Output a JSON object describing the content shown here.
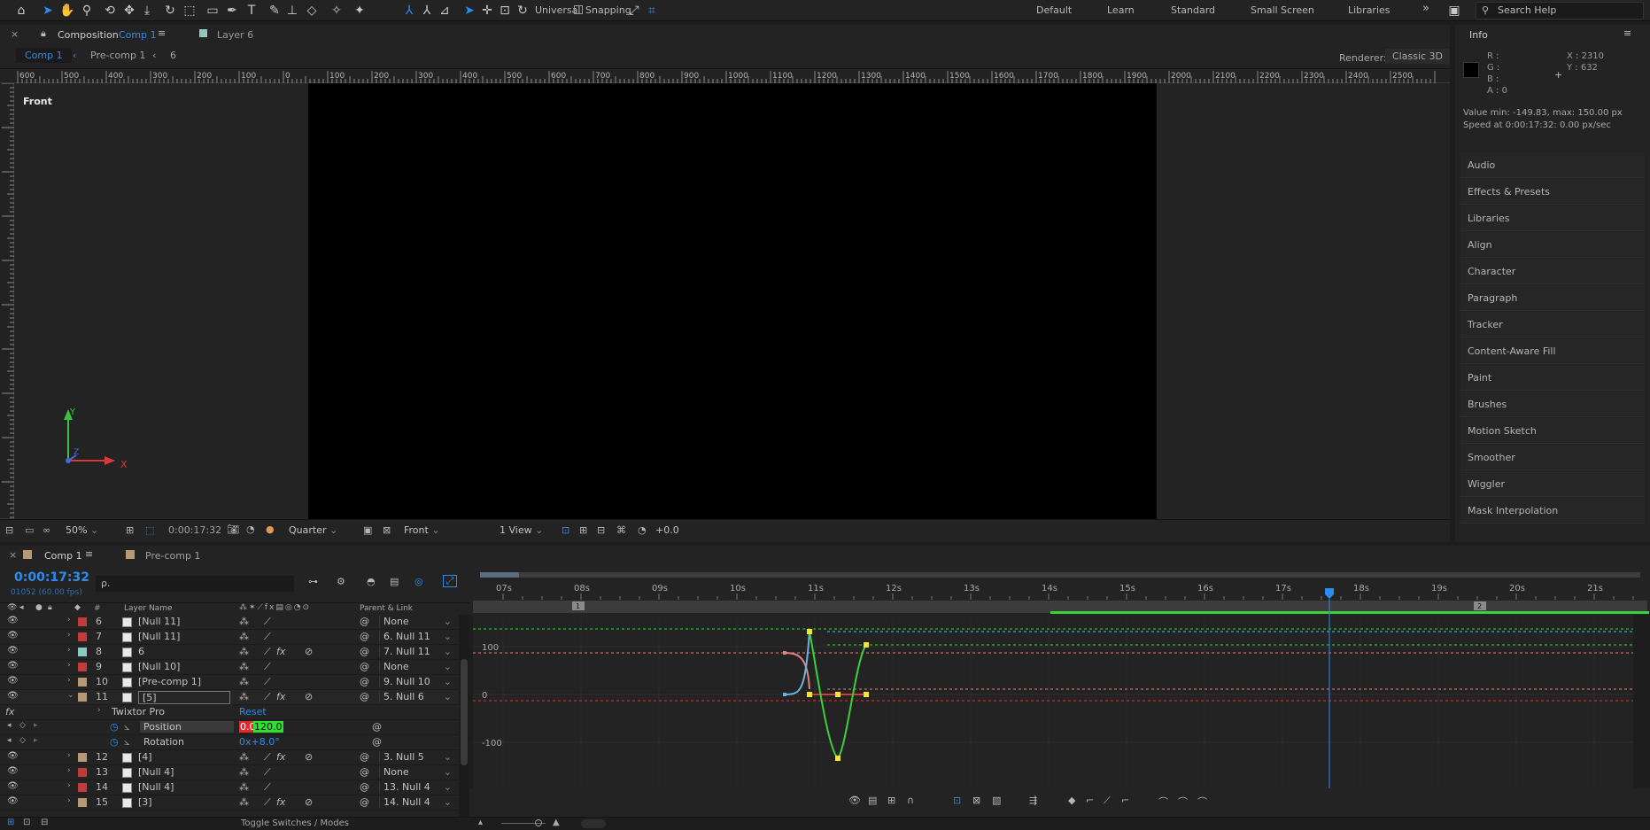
{
  "toolbar": {
    "universal_label": "Universal",
    "snapping_label": "Snapping",
    "workspaces": [
      "Default",
      "Learn",
      "Standard",
      "Small Screen",
      "Libraries"
    ],
    "more": "»",
    "search_placeholder": "Search Help"
  },
  "comp_panel": {
    "tab_label": "Composition",
    "tab_name": "Comp 1",
    "layer_tab": "Layer 6",
    "breadcrumb": [
      "Comp 1",
      "Pre-comp 1",
      "6"
    ],
    "renderer_label": "Renderer:",
    "renderer_value": "Classic 3D",
    "view_label": "Front",
    "ruler_ticks": [
      "600",
      "500",
      "400",
      "300",
      "200",
      "100",
      "0",
      "100",
      "200",
      "300",
      "400",
      "500",
      "600",
      "700",
      "800",
      "900",
      "1000",
      "1100",
      "1200",
      "1300",
      "1400",
      "1500",
      "1600",
      "1700",
      "1800",
      "1900",
      "2000",
      "2100",
      "2200",
      "2300",
      "2400",
      "2500"
    ],
    "axis_x": "X",
    "axis_y": "Y",
    "axis_z": "Z",
    "footer": {
      "zoom": "50%",
      "timecode": "0:00:17:32",
      "resolution": "Quarter",
      "view": "Front",
      "views": "1 View",
      "exposure": "+0.0"
    }
  },
  "info_panel": {
    "title": "Info",
    "r": "R :",
    "g": "G :",
    "b": "B :",
    "a": "A :  0",
    "x": "X : 2310",
    "y": "Y :  632",
    "value_line": "Value min: -149.83, max: 150.00 px",
    "speed_line": "Speed at 0:00:17:32: 0.00 px/sec",
    "items": [
      "Audio",
      "Effects & Presets",
      "Libraries",
      "Align",
      "Character",
      "Paragraph",
      "Tracker",
      "Content-Aware Fill",
      "Paint",
      "Brushes",
      "Motion Sketch",
      "Smoother",
      "Wiggler",
      "Mask Interpolation"
    ]
  },
  "timeline": {
    "tabs": [
      "Comp 1",
      "Pre-comp 1"
    ],
    "timecode": "0:00:17:32",
    "frame_info": "01052 (60.00 fps)",
    "search_placeholder": "ρ.",
    "col_hash": "#",
    "col_layer_name": "Layer Name",
    "col_parent": "Parent & Link",
    "layers": [
      {
        "num": "6",
        "name": "[Null 11]",
        "parent": "None",
        "color": "#c23b3b",
        "fx": false
      },
      {
        "num": "7",
        "name": "[Null 11]",
        "parent": "6. Null 11",
        "color": "#c23b3b",
        "fx": false
      },
      {
        "num": "8",
        "name": "6",
        "parent": "7. Null 11",
        "color": "#8fc9c2",
        "fx": true
      },
      {
        "num": "9",
        "name": "[Null 10]",
        "parent": "None",
        "color": "#c23b3b",
        "fx": false
      },
      {
        "num": "10",
        "name": "[Pre-comp 1]",
        "parent": "9. Null 10",
        "color": "#b69a74",
        "fx": false
      },
      {
        "num": "11",
        "name": "[5]",
        "parent": "5. Null 6",
        "color": "#b69a74",
        "fx": true
      }
    ],
    "effect_name": "Twixtor Pro",
    "effect_reset": "Reset",
    "props": [
      {
        "name": "Position",
        "value_a": "0.0",
        "value_b": "120.0"
      },
      {
        "name": "Rotation",
        "value_a": "0x+8.0°",
        "value_b": ""
      }
    ],
    "layers_after": [
      {
        "num": "12",
        "name": "[4]",
        "parent": "3. Null 5",
        "color": "#b69a74",
        "fx": true
      },
      {
        "num": "13",
        "name": "[Null 4]",
        "parent": "None",
        "color": "#c23b3b",
        "fx": false
      },
      {
        "num": "14",
        "name": "[Null 4]",
        "parent": "13. Null 4",
        "color": "#c23b3b",
        "fx": false
      },
      {
        "num": "15",
        "name": "[3]",
        "parent": "14. Null 4",
        "color": "#b69a74",
        "fx": true
      }
    ],
    "time_ticks": [
      "07s",
      "08s",
      "09s",
      "10s",
      "11s",
      "12s",
      "13s",
      "14s",
      "15s",
      "16s",
      "17s",
      "18s",
      "19s",
      "20s",
      "21s"
    ],
    "graph_labels": [
      "100",
      "0",
      "-100"
    ],
    "marker_1": "1",
    "marker_2": "2",
    "toggle_label": "Toggle Switches / Modes"
  }
}
